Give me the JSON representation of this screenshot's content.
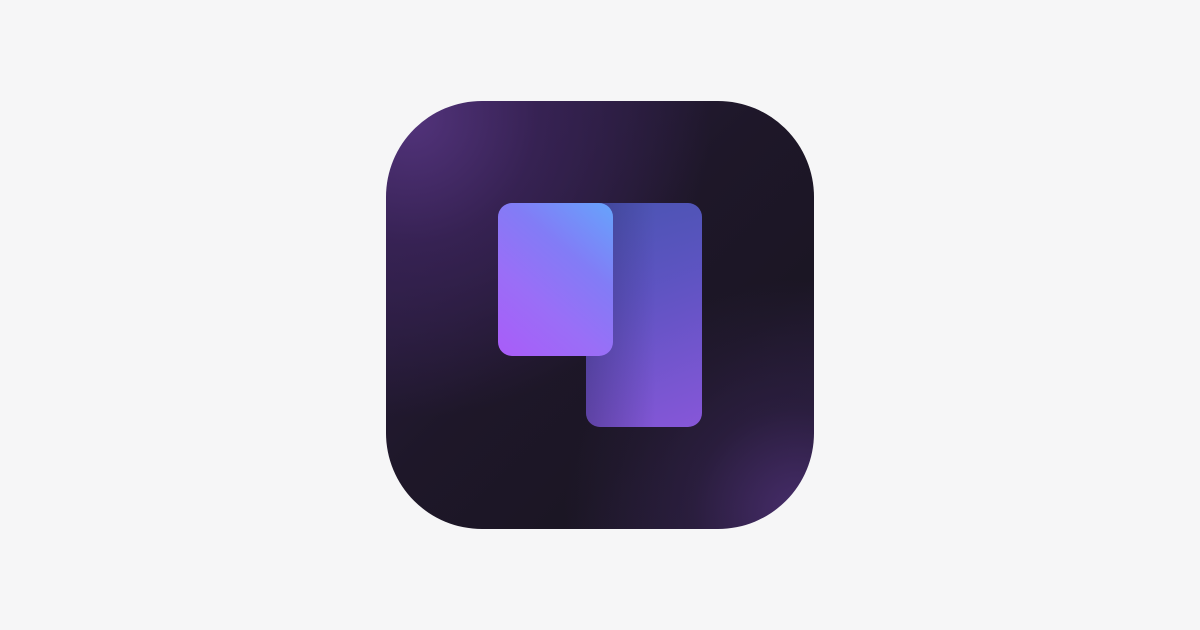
{
  "app_icon": {
    "name": "app-icon",
    "colors": {
      "page_background": "#f6f6f7",
      "tile_dark": "#1c1626",
      "tile_glow": "#4a2e70",
      "front_card_top": "#66a4fc",
      "front_card_bottom": "#a95cf8",
      "back_card": "#7a64d8"
    }
  }
}
